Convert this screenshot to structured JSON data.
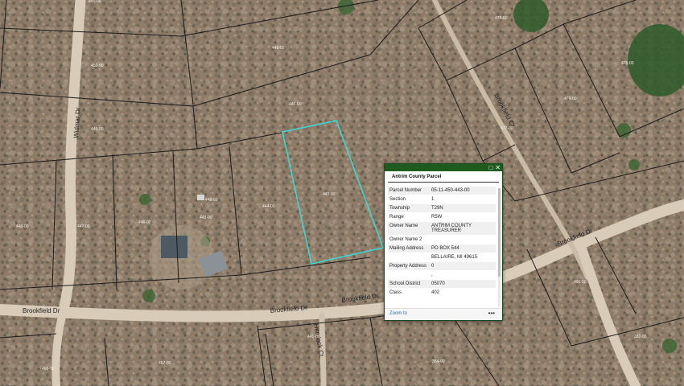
{
  "map": {
    "road_labels": {
      "widmar": "Widmar Dr",
      "brookfield_west": "Brookfield Dr",
      "brookfield_mid": "Brookfield Dr",
      "brookfield_mid2": "Brookfield Dr",
      "brookfield_east": "Brookfield Dr",
      "brookfield_ct": "Brookfield Ct",
      "hemlock_ct": "Hemlock Ct"
    },
    "parcel_labels": {
      "p451": "451-00",
      "p450": "450-00",
      "p448": "448-00",
      "p449": "449-00",
      "p445": "445-00",
      "p447": "447-00",
      "p446": "446-00",
      "p444": "444-00",
      "p443": "443-00",
      "p478": "478-00",
      "p476": "476-00",
      "p475": "475-00",
      "p477": "477-00",
      "p491": "491-00",
      "p382": "382-00",
      "p441": "441-00",
      "p384": "384-00",
      "p467": "467-00",
      "p466": "466-00",
      "p446b": "446-00",
      "p448b": "448-00",
      "p449b": "449-00"
    },
    "highlight_color": "#3fd6d6"
  },
  "popup": {
    "title": "Antrim County Parcel",
    "rows": [
      {
        "label": "Parcel Number",
        "value": "05-11-450-443-00"
      },
      {
        "label": "Section",
        "value": "1"
      },
      {
        "label": "Township",
        "value": "T29N"
      },
      {
        "label": "Range",
        "value": "R5W"
      },
      {
        "label": "Owner Name",
        "value": "ANTRIM COUNTY TREASURER"
      },
      {
        "label": "Owner Name 2",
        "value": ""
      },
      {
        "label": "Mailing Address",
        "value": "PO BOX 544"
      },
      {
        "label": "",
        "value": "BELLAIRE, MI 49615"
      },
      {
        "label": "Property Address",
        "value": "0"
      },
      {
        "label": "",
        "value": ","
      },
      {
        "label": "School District",
        "value": "05070"
      },
      {
        "label": "Class",
        "value": "402"
      }
    ],
    "zoom_label": "Zoom to",
    "more_label": "•••",
    "maximize_icon": "maximize-icon",
    "close_icon": "close-icon"
  }
}
